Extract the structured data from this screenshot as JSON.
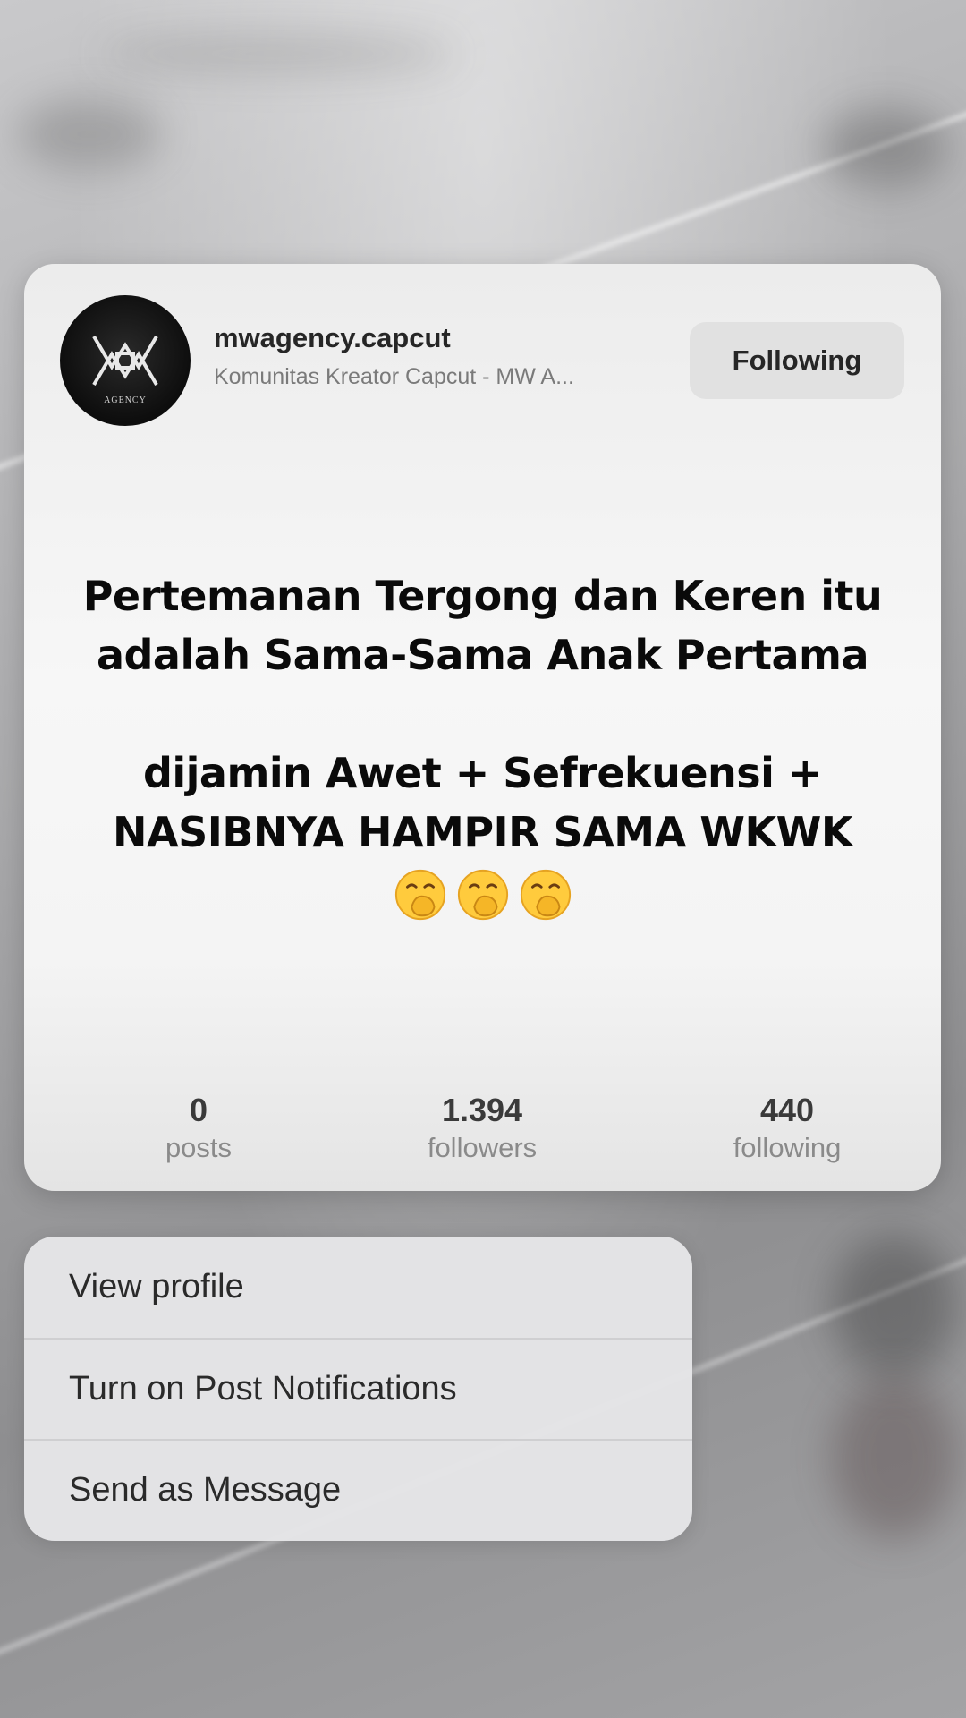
{
  "profile": {
    "username": "mwagency.capcut",
    "subtitle": "Komunitas Kreator Capcut - MW A...",
    "follow_label": "Following",
    "avatar_icon": "mw-agency-logo",
    "bio_text": "Pertemanan Tergong dan Keren itu adalah Sama-Sama Anak Pertama\n\ndijamin Awet + Sefrekuensi + NASIBNYA HAMPIR SAMA WKWK",
    "bio_emojis": [
      "face-with-hand-over-mouth",
      "face-with-hand-over-mouth",
      "face-with-hand-over-mouth"
    ]
  },
  "stats": [
    {
      "value": "0",
      "label": "posts"
    },
    {
      "value": "1.394",
      "label": "followers"
    },
    {
      "value": "440",
      "label": "following"
    }
  ],
  "menu": [
    {
      "label": "View profile"
    },
    {
      "label": "Turn on Post Notifications"
    },
    {
      "label": "Send as Message"
    }
  ],
  "colors": {
    "card_bg": "#f5f5f5",
    "button_bg": "#e1e1e1",
    "menu_bg": "#e6e6e8"
  }
}
